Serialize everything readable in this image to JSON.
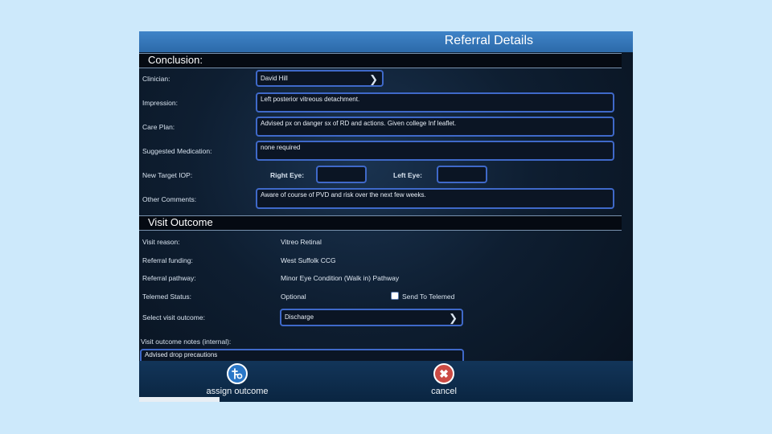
{
  "window": {
    "title": "Referral Details"
  },
  "conclusion": {
    "header": "Conclusion:",
    "clinician_label": "Clinician:",
    "clinician_value": "David Hill",
    "impression_label": "Impression:",
    "impression_value": "Left posterior vitreous detachment.",
    "care_plan_label": "Care Plan:",
    "care_plan_value": "Advised px on danger sx of RD and actions.  Given college Inf leaflet.",
    "medication_label": "Suggested Medication:",
    "medication_value": "none required",
    "target_iop_label": "New Target IOP:",
    "right_eye_label": "Right Eye:",
    "right_eye_value": "",
    "left_eye_label": "Left Eye:",
    "left_eye_value": "",
    "comments_label": "Other Comments:",
    "comments_value": "Aware of course of PVD and risk over the next few weeks."
  },
  "visit_outcome": {
    "header": "Visit Outcome",
    "reason_label": "Visit reason:",
    "reason_value": "Vitreo Retinal",
    "funding_label": "Referral funding:",
    "funding_value": "West Suffolk CCG",
    "pathway_label": "Referral pathway:",
    "pathway_value": "Minor Eye Condition (Walk in) Pathway",
    "telemed_label": "Telemed Status:",
    "telemed_value": "Optional",
    "send_telemed_label": "Send To Telemed",
    "send_telemed_checked": false,
    "select_outcome_label": "Select visit outcome:",
    "select_outcome_value": "Discharge",
    "notes_label": "Visit outcome notes (internal):",
    "notes_value": "Advised drop precautions"
  },
  "actions": {
    "assign_label": "assign outcome",
    "cancel_label": "cancel"
  },
  "colors": {
    "accent": "#3f69c9",
    "title_bar": "#3a7ec2",
    "assign_button": "#2a77c7",
    "cancel_button": "#cc4b44"
  },
  "icons": {
    "assign": "assign-outcome-icon",
    "cancel": "close-icon",
    "chevron": "chevron-right-icon"
  }
}
